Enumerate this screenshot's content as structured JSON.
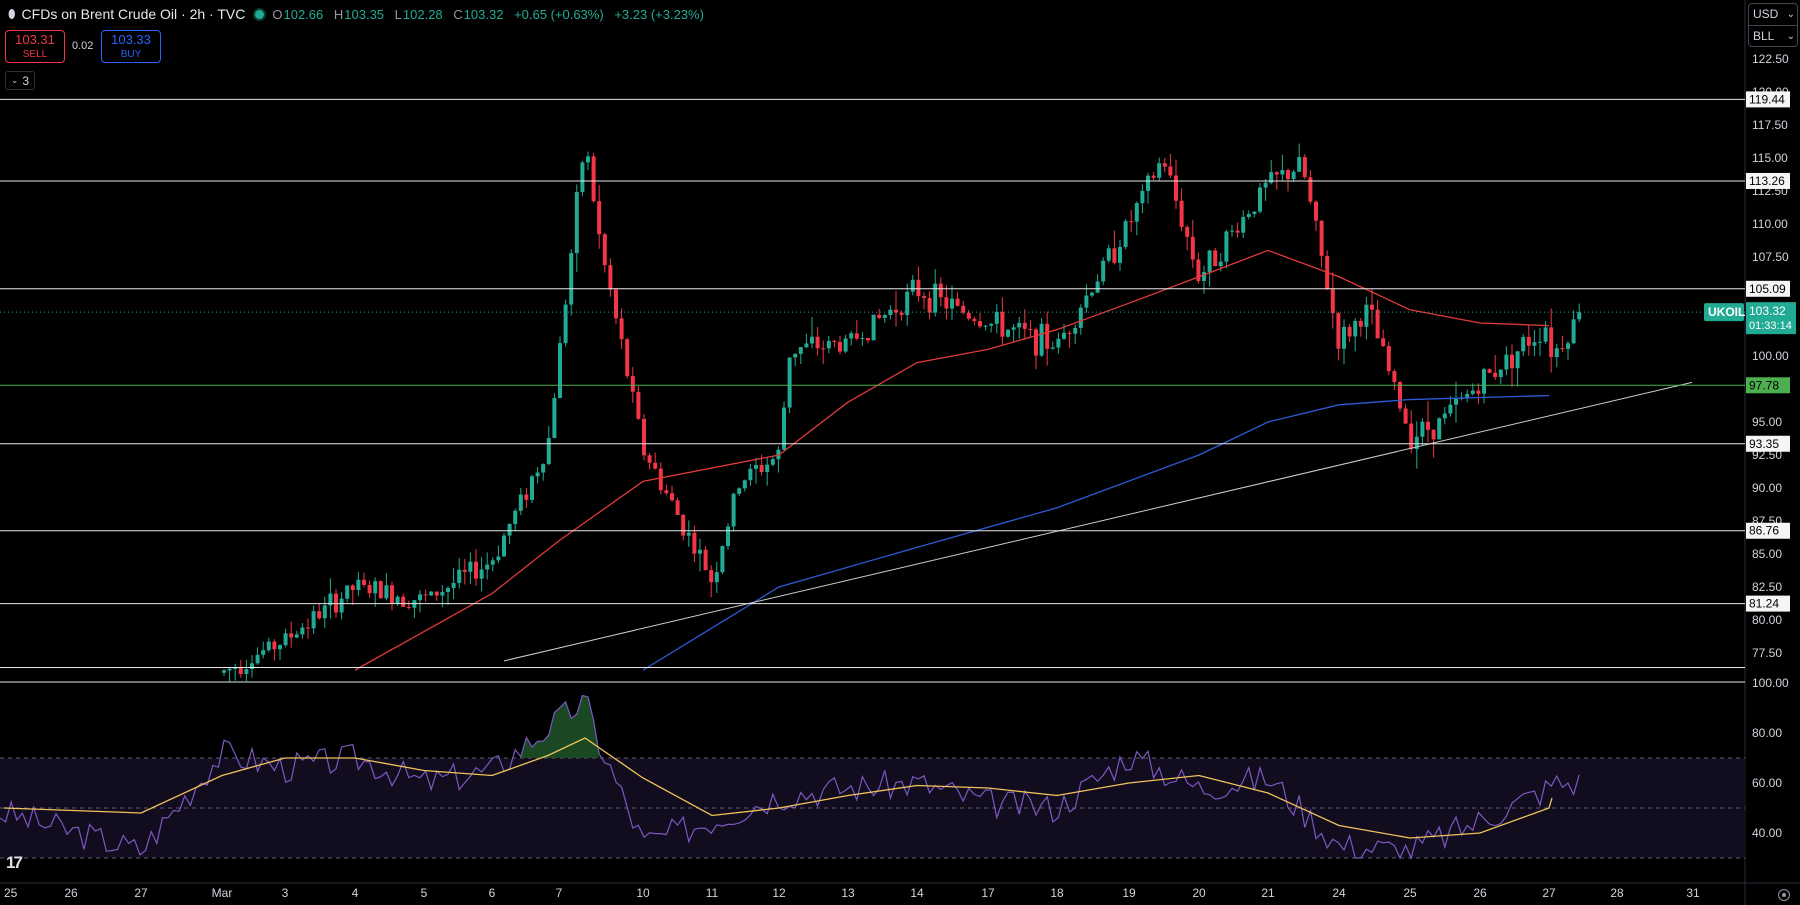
{
  "header": {
    "symbol": "CFDs on Brent Crude Oil · 2h · TVC",
    "open": "102.66",
    "high": "103.35",
    "low": "102.28",
    "close": "103.32",
    "change": "+0.65 (+0.63%)",
    "change2": "+3.23 (+3.23%)"
  },
  "trade": {
    "sell_price": "103.31",
    "sell_label": "SELL",
    "buy_price": "103.33",
    "buy_label": "BUY",
    "spread": "0.02",
    "indicator_count": "3"
  },
  "currency": {
    "currency": "USD",
    "unit": "BLL"
  },
  "colors": {
    "up": "#22ab94",
    "down": "#f23645",
    "ma_fast": "#e03a3a",
    "ma_slow": "#2d5bd6",
    "rsi": "#7e57c2",
    "rsi_ma": "#f0c35a",
    "levels": "#e8e8e8",
    "support": "#4caf50"
  },
  "chart_data": [
    {
      "type": "candlestick",
      "title": "CFDs on Brent Crude Oil · 2h · TVC",
      "ylim": [
        75.3,
        122.5
      ],
      "y_ticks": [
        "77.50",
        "80.00",
        "82.50",
        "85.00",
        "87.50",
        "90.00",
        "92.50",
        "95.00",
        "97.50",
        "100.00",
        "102.50",
        "105.00",
        "107.50",
        "110.00",
        "112.50",
        "115.00",
        "117.50",
        "120.00",
        "122.50"
      ],
      "x_ticks": [
        "25",
        "26",
        "27",
        "Mar",
        "3",
        "4",
        "5",
        "6",
        "7",
        "10",
        "11",
        "12",
        "13",
        "14",
        "17",
        "18",
        "19",
        "20",
        "21",
        "24",
        "25",
        "26",
        "27",
        "28",
        "31"
      ],
      "last_price": {
        "label": "UKOIL",
        "value": "103.32",
        "countdown": "01:33:14"
      },
      "horizontal_levels": [
        {
          "value": 119.44,
          "label": "119.44",
          "style": "white"
        },
        {
          "value": 113.26,
          "label": "113.26",
          "style": "white"
        },
        {
          "value": 105.09,
          "label": "105.09",
          "style": "white"
        },
        {
          "value": 97.78,
          "label": "97.78",
          "style": "green"
        },
        {
          "value": 93.35,
          "label": "93.35",
          "style": "white"
        },
        {
          "value": 86.76,
          "label": "86.76",
          "style": "white"
        },
        {
          "value": 81.24,
          "label": "81.24",
          "style": "white"
        },
        {
          "value": 76.4,
          "label": "",
          "style": "white"
        }
      ],
      "trendline": [
        [
          "Mar 6",
          76.9
        ],
        [
          "Mar 31",
          98.0
        ]
      ],
      "price_path": [
        [
          "Feb 28",
          76
        ],
        [
          "Mar 3",
          78.5
        ],
        [
          "Mar 4",
          82.5
        ],
        [
          "Mar 5",
          81.5
        ],
        [
          "Mar 6",
          84.5
        ],
        [
          "Mar 7 (a)",
          93.2
        ],
        [
          "Mar 7 (b)",
          116.5
        ],
        [
          "Mar 7 (c)",
          108.5
        ],
        [
          "Mar 10",
          93
        ],
        [
          "Mar 10 (b)",
          90.5
        ],
        [
          "Mar 11",
          83
        ],
        [
          "Mar 11 (b)",
          90.5
        ],
        [
          "Mar 12",
          92.5
        ],
        [
          "Mar 12 (b)",
          100.5
        ],
        [
          "Mar 13",
          101
        ],
        [
          "Mar 14",
          105
        ],
        [
          "Mar 17",
          102.5
        ],
        [
          "Mar 18",
          100.8
        ],
        [
          "Mar 19",
          110
        ],
        [
          "Mar 19 (b)",
          115
        ],
        [
          "Mar 20",
          106
        ],
        [
          "Mar 21",
          113
        ],
        [
          "Mar 21 (b)",
          114.5
        ],
        [
          "Mar 24",
          101
        ],
        [
          "Mar 24 (b)",
          103.5
        ],
        [
          "Mar 25",
          94
        ],
        [
          "Mar 25 (b)",
          95
        ],
        [
          "Mar 26",
          98
        ],
        [
          "Mar 27",
          102.5
        ],
        [
          "Mar 27 (b)",
          100
        ],
        [
          "Mar 27 (c)",
          103.32
        ]
      ],
      "ma_fast_path": [
        [
          "Mar 4",
          76.2
        ],
        [
          "Mar 6",
          82
        ],
        [
          "Mar 7",
          86
        ],
        [
          "Mar 10",
          90.5
        ],
        [
          "Mar 12",
          92.5
        ],
        [
          "Mar 13",
          96.5
        ],
        [
          "Mar 14",
          99.5
        ],
        [
          "Mar 17",
          100.5
        ],
        [
          "Mar 18",
          102
        ],
        [
          "Mar 19",
          104
        ],
        [
          "Mar 20",
          106
        ],
        [
          "Mar 21",
          108
        ],
        [
          "Mar 24",
          106
        ],
        [
          "Mar 25",
          103.5
        ],
        [
          "Mar 26",
          102.5
        ],
        [
          "Mar 27",
          102.3
        ]
      ],
      "ma_slow_path": [
        [
          "Mar 10",
          76.2
        ],
        [
          "Mar 12",
          82.5
        ],
        [
          "Mar 14",
          85.5
        ],
        [
          "Mar 18",
          88.5
        ],
        [
          "Mar 20",
          92.5
        ],
        [
          "Mar 21",
          95
        ],
        [
          "Mar 24",
          96.3
        ],
        [
          "Mar 25",
          96.7
        ],
        [
          "Mar 27",
          97
        ]
      ]
    },
    {
      "type": "line",
      "title": "RSI",
      "ylim": [
        20,
        100
      ],
      "y_ticks": [
        "100.00",
        "80.00",
        "60.00",
        "40.00"
      ],
      "bands": [
        70,
        50,
        30
      ],
      "series": [
        {
          "name": "",
          "color": "#7e57c2",
          "values": [
            [
              "Feb 25",
              48
            ],
            [
              "Feb 27",
              33
            ],
            [
              "Mar",
              72
            ],
            [
              "Mar 3",
              66
            ],
            [
              "Mar 4",
              70
            ],
            [
              "Mar 5",
              60
            ],
            [
              "Mar 6",
              65
            ],
            [
              "Mar 7 (a)",
              82
            ],
            [
              "Mar 7 (b)",
              93
            ],
            [
              "Mar 7 (c)",
              75
            ],
            [
              "Mar 10",
              36
            ],
            [
              "Mar 11",
              45
            ],
            [
              "Mar 12",
              55
            ],
            [
              "Mar 13",
              58
            ],
            [
              "Mar 14",
              60
            ],
            [
              "Mar 17",
              52
            ],
            [
              "Mar 18",
              50
            ],
            [
              "Mar 19",
              71
            ],
            [
              "Mar 20",
              58
            ],
            [
              "Mar 21",
              62
            ],
            [
              "Mar 24",
              35
            ],
            [
              "Mar 25",
              33
            ],
            [
              "Mar 26",
              45
            ],
            [
              "Mar 27",
              58
            ],
            [
              "Mar 27 (b)",
              60
            ]
          ]
        },
        {
          "name": "",
          "color": "#f0c35a",
          "values": [
            [
              "Feb 25",
              50
            ],
            [
              "Feb 27",
              48
            ],
            [
              "Mar",
              63
            ],
            [
              "Mar 3",
              70
            ],
            [
              "Mar 4",
              70
            ],
            [
              "Mar 5",
              65
            ],
            [
              "Mar 6",
              63
            ],
            [
              "Mar 7 (a)",
              71
            ],
            [
              "Mar 7 (b)",
              78
            ],
            [
              "Mar 10",
              62
            ],
            [
              "Mar 11",
              47
            ],
            [
              "Mar 12",
              50
            ],
            [
              "Mar 13",
              55
            ],
            [
              "Mar 14",
              59
            ],
            [
              "Mar 17",
              58
            ],
            [
              "Mar 18",
              55
            ],
            [
              "Mar 19",
              60
            ],
            [
              "Mar 20",
              63
            ],
            [
              "Mar 21",
              56
            ],
            [
              "Mar 24",
              43
            ],
            [
              "Mar 25",
              38
            ],
            [
              "Mar 26",
              40
            ],
            [
              "Mar 27",
              50
            ],
            [
              "Mar 27 (b)",
              54
            ]
          ]
        }
      ]
    }
  ]
}
